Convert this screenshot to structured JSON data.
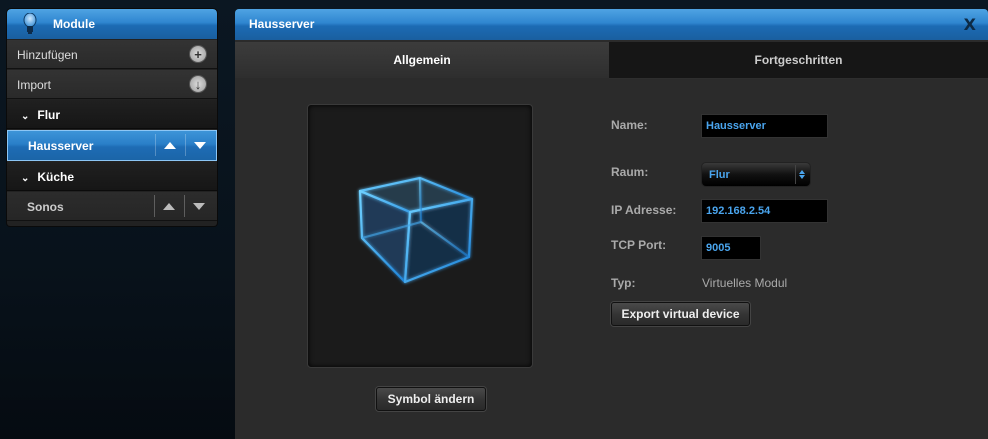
{
  "sidebar": {
    "title": "Module",
    "items": [
      {
        "label": "Hinzufügen",
        "action_icon": "plus-icon",
        "action_glyph": "+"
      },
      {
        "label": "Import",
        "action_icon": "download-icon",
        "action_glyph": "↓"
      },
      {
        "label": "Flur",
        "type": "group"
      },
      {
        "label": "Hausserver",
        "type": "child",
        "selected": true
      },
      {
        "label": "Küche",
        "type": "group"
      },
      {
        "label": "Sonos",
        "type": "child",
        "selected": false
      }
    ]
  },
  "dialog": {
    "title": "Hausserver",
    "close_label": "X",
    "tabs": [
      {
        "label": "Allgemein",
        "active": true
      },
      {
        "label": "Fortgeschritten",
        "active": false
      }
    ],
    "change_symbol_button": "Symbol ändern",
    "fields": {
      "name": {
        "label": "Name:",
        "value": "Hausserver"
      },
      "room": {
        "label": "Raum:",
        "value": "Flur"
      },
      "ip": {
        "label": "IP Adresse:",
        "value": "192.168.2.54"
      },
      "port": {
        "label": "TCP Port:",
        "value": "9005"
      },
      "type": {
        "label": "Typ:",
        "value": "Virtuelles Modul"
      }
    },
    "export_button": "Export virtual device"
  },
  "colors": {
    "accent_blue": "#2f86d0",
    "value_blue": "#4aa5ee",
    "panel_bg": "#2b2b2b"
  }
}
